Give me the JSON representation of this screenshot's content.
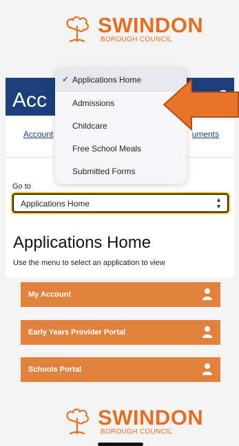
{
  "brand": {
    "name": "SWINDON",
    "subtitle": "BOROUGH COUNCIL",
    "color": "#e36f24"
  },
  "hero": {
    "title_visible": "Acc",
    "color": "#1a3f7a"
  },
  "links": {
    "left": "Account",
    "right": "uments"
  },
  "goto": {
    "label": "Go to",
    "selected": "Applications Home"
  },
  "section": {
    "title": "Applications Home",
    "subtitle": "Use the menu to select an application to view"
  },
  "tiles": [
    {
      "label": "My Account",
      "icon": "user-icon"
    },
    {
      "label": "Early Years Provider Portal",
      "icon": "user-icon"
    },
    {
      "label": "Schools Portal",
      "icon": "user-icon"
    }
  ],
  "menu": {
    "check": "✓",
    "items": [
      {
        "label": "Applications Home",
        "selected": true
      },
      {
        "label": "Admissions",
        "selected": false
      },
      {
        "label": "Childcare",
        "selected": false
      },
      {
        "label": "Free School Meals",
        "selected": false
      },
      {
        "label": "Submitted Forms",
        "selected": false
      }
    ]
  },
  "colors": {
    "tile": "#e0823d",
    "focus": "#f6c200",
    "arrow": "#e8732a"
  }
}
